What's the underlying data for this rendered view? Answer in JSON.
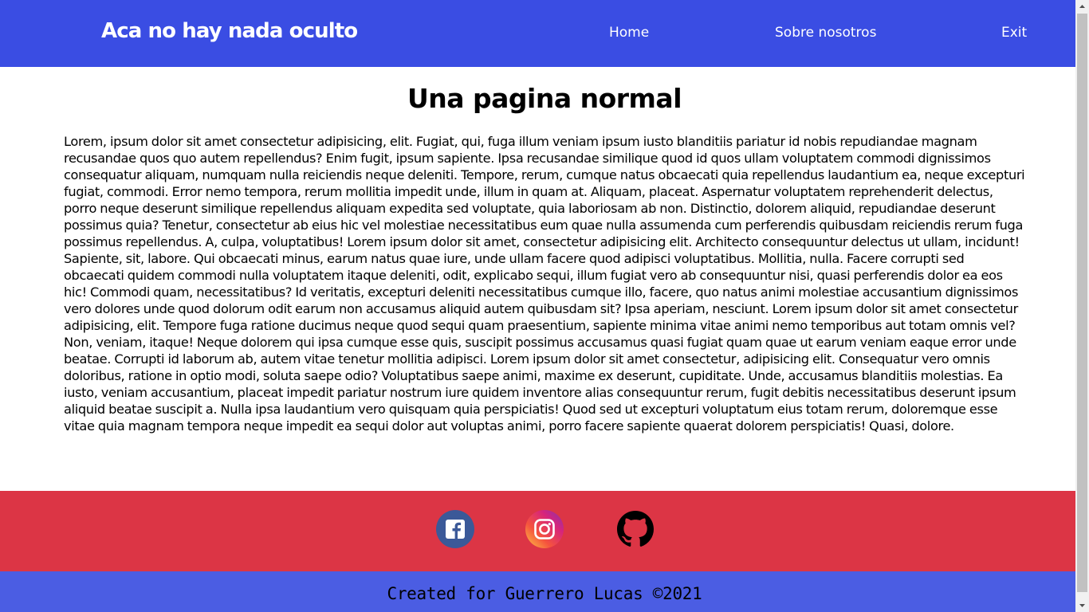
{
  "navbar": {
    "brand": "Aca no hay nada oculto",
    "links": [
      "Home",
      "Sobre nosotros",
      "Exit"
    ],
    "background": "#3a4de3"
  },
  "main": {
    "title": "Una pagina normal",
    "paragraph": "Lorem, ipsum dolor sit amet consectetur adipisicing, elit. Fugiat, qui, fuga illum veniam ipsum iusto blanditiis pariatur id nobis repudiandae magnam recusandae quos quo autem repellendus? Enim fugit, ipsum sapiente. Ipsa recusandae similique quod id quos ullam voluptatem commodi dignissimos consequatur aliquam, numquam nulla reiciendis neque deleniti. Tempore, rerum, cumque natus obcaecati quia repellendus laudantium ea, neque excepturi fugiat, commodi. Error nemo tempora, rerum mollitia impedit unde, illum in quam at. Aliquam, placeat. Aspernatur voluptatem reprehenderit delectus, porro neque deserunt similique repellendus aliquam expedita sed voluptate, quia laboriosam ab non. Distinctio, dolorem aliquid, repudiandae deserunt possimus quia? Tenetur, consectetur ab eius hic vel molestiae necessitatibus eum quae nulla assumenda cum perferendis quibusdam reiciendis rerum fuga possimus repellendus. A, culpa, voluptatibus! Lorem ipsum dolor sit amet, consectetur adipisicing elit. Architecto consequuntur delectus ut ullam, incidunt! Sapiente, sit, labore. Qui obcaecati minus, earum natus quae iure, unde ullam facere quod adipisci voluptatibus. Mollitia, nulla. Facere corrupti sed obcaecati quidem commodi nulla voluptatem itaque deleniti, odit, explicabo sequi, illum fugiat vero ab consequuntur nisi, quasi perferendis dolor ea eos hic! Commodi quam, necessitatibus? Id veritatis, excepturi deleniti necessitatibus cumque illo, facere, quo natus animi molestiae accusantium dignissimos vero dolores unde quod dolorum odit earum non accusamus aliquid autem quibusdam sit? Ipsa aperiam, nesciunt. Lorem ipsum dolor sit amet consectetur adipisicing, elit. Tempore fuga ratione ducimus neque quod sequi quam praesentium, sapiente minima vitae animi nemo temporibus aut totam omnis vel? Non, veniam, itaque! Neque dolorem qui ipsa cumque esse quis, suscipit possimus accusamus quasi fugiat quam quae ut earum veniam eaque error unde beatae. Corrupti id laborum ab, autem vitae tenetur mollitia adipisci. Lorem ipsum dolor sit amet consectetur, adipisicing elit. Consequatur vero omnis doloribus, ratione in optio modi, soluta saepe odio? Voluptatibus saepe animi, maxime ex deserunt, cupiditate. Unde, accusamus blanditiis molestias. Ea iusto, veniam accusantium, placeat impedit pariatur nostrum iure quidem inventore alias consequuntur rerum, fugit debitis necessitatibus deserunt ipsum aliquid beatae suscipit a. Nulla ipsa laudantium vero quisquam quia perspiciatis! Quod sed ut excepturi voluptatum eius totam rerum, doloremque esse vitae quia magnam tempora neque impedit ea sequi dolor aut voluptas animi, porro facere sapiente quaerat dolorem perspiciatis! Quasi, dolore."
  },
  "social": {
    "background": "#dc3545",
    "icons": [
      "facebook-icon",
      "instagram-icon",
      "github-icon"
    ]
  },
  "footer": {
    "text": "Created for Guerrero Lucas ©2021",
    "background": "#4b5de3"
  }
}
